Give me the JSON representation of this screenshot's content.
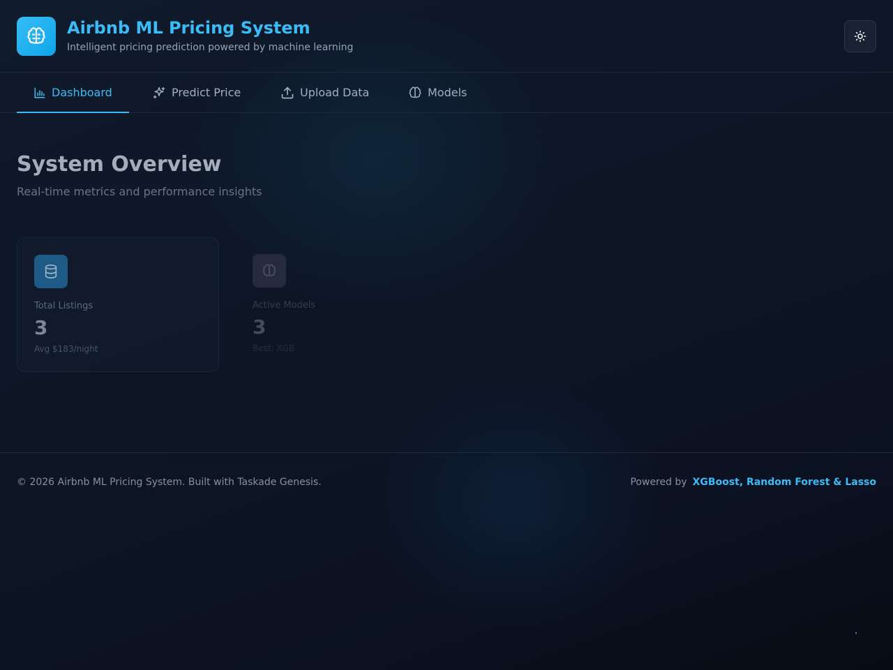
{
  "header": {
    "title": "Airbnb ML Pricing System",
    "subtitle": "Intelligent pricing prediction powered by machine learning",
    "logo_icon": "brain-icon",
    "theme_toggle_icon": "sun-icon"
  },
  "nav": {
    "tabs": [
      {
        "label": "Dashboard",
        "icon": "bar-chart-icon",
        "active": true
      },
      {
        "label": "Predict Price",
        "icon": "sparkles-icon",
        "active": false
      },
      {
        "label": "Upload Data",
        "icon": "upload-icon",
        "active": false
      },
      {
        "label": "Models",
        "icon": "brain-icon",
        "active": false
      }
    ]
  },
  "overview": {
    "title": "System Overview",
    "subtitle": "Real-time metrics and performance insights"
  },
  "cards": [
    {
      "label": "Total Listings",
      "value": "3",
      "note": "Avg $183/night",
      "icon": "database-icon"
    },
    {
      "label": "Active Models",
      "value": "3",
      "note": "Best: XGB",
      "icon": "brain-icon"
    }
  ],
  "footer": {
    "copyright": "© 2026 Airbnb ML Pricing System. Built with Taskade Genesis.",
    "powered_label": "Powered by",
    "powered_tech": "XGBoost, Random Forest & Lasso"
  },
  "colors": {
    "accent": "#38bdf8",
    "background": "#0e1626"
  }
}
